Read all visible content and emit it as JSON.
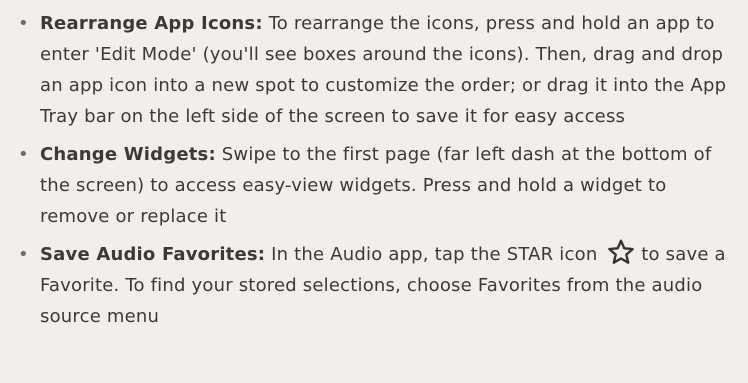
{
  "tips": [
    {
      "bullet": "•",
      "title": "Rearrange App Icons:",
      "text": " To rearrange the icons, press and hold an app to enter 'Edit Mode' (you'll see boxes around the icons). Then, drag and drop an app icon into a new spot to customize the order; or drag it into the App Tray bar on the left side of the screen to save it for easy access"
    },
    {
      "bullet": "•",
      "title": "Change Widgets:",
      "text": " Swipe to the first page (far left dash at the bottom of the screen) to access easy-view widgets. Press and hold a widget to remove or replace it"
    },
    {
      "bullet": "•",
      "title": "Save Audio Favorites:",
      "text_before_icon": " In the Audio app, tap the STAR icon",
      "icon": "star-outline-icon",
      "text_after_icon": " to save a Favorite. To find your stored selections, choose Favorites from the audio source menu"
    }
  ]
}
